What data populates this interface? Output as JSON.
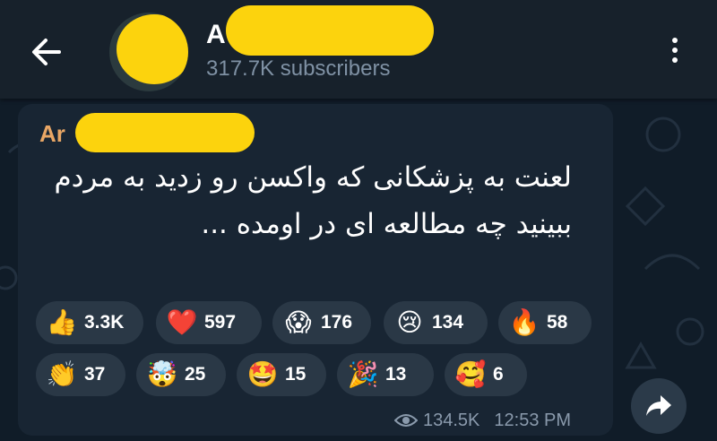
{
  "header": {
    "title": "A",
    "subtitle": "317.7K subscribers"
  },
  "message": {
    "author": "Ar",
    "text": "لعنت به پزشکانی که واکسن رو زدید به مردم\nببینید چه مطالعه ای در اومده ...",
    "reactions": [
      {
        "emoji": "👍",
        "count": "3.3K"
      },
      {
        "emoji": "❤️",
        "count": "597"
      },
      {
        "emoji": "😱",
        "count": "176"
      },
      {
        "emoji": "😢",
        "count": "134"
      },
      {
        "emoji": "🔥",
        "count": "58"
      },
      {
        "emoji": "👏",
        "count": "37"
      },
      {
        "emoji": "🤯",
        "count": "25"
      },
      {
        "emoji": "🤩",
        "count": "15"
      },
      {
        "emoji": "🎉",
        "count": "13"
      },
      {
        "emoji": "🥰",
        "count": "6"
      }
    ],
    "views": "134.5K",
    "time": "12:53 PM"
  },
  "icons": {
    "back": "arrow-left-icon",
    "menu": "more-vertical-icon",
    "views": "eye-icon",
    "share": "share-arrow-icon"
  },
  "colors": {
    "accent_author": "#e8a665",
    "redaction": "#fcd30d",
    "header_bg": "#17212b",
    "bubble_bg": "#182533"
  }
}
